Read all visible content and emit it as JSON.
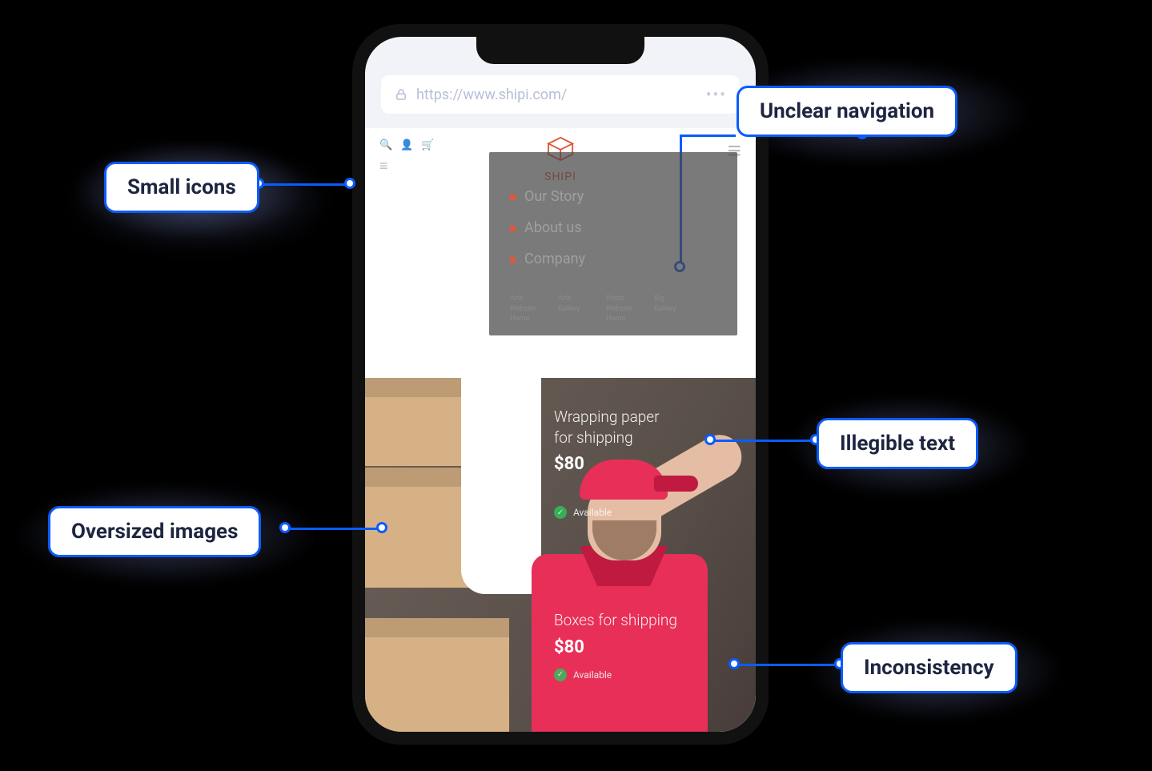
{
  "browser": {
    "url": "https://www.shipi.com/"
  },
  "brand": "SHIPI",
  "menu": {
    "items": [
      "Our Story",
      "About us",
      "Company"
    ],
    "sublinks": [
      "Arts\nWebsite\nHome",
      "Arts\nGallery",
      "Prints\nWebsite\nHome",
      "Big\nGallery"
    ]
  },
  "products": [
    {
      "title": "Wrapping paper\nfor shipping",
      "price": "$80",
      "status": "Available"
    },
    {
      "title": "Boxes for shipping",
      "price": "$80",
      "status": "Available"
    }
  ],
  "callouts": {
    "small_icons": "Small icons",
    "unclear_nav": "Unclear navigation",
    "oversized": "Oversized images",
    "illegible": "Illegible text",
    "inconsistency": "Inconsistency"
  }
}
